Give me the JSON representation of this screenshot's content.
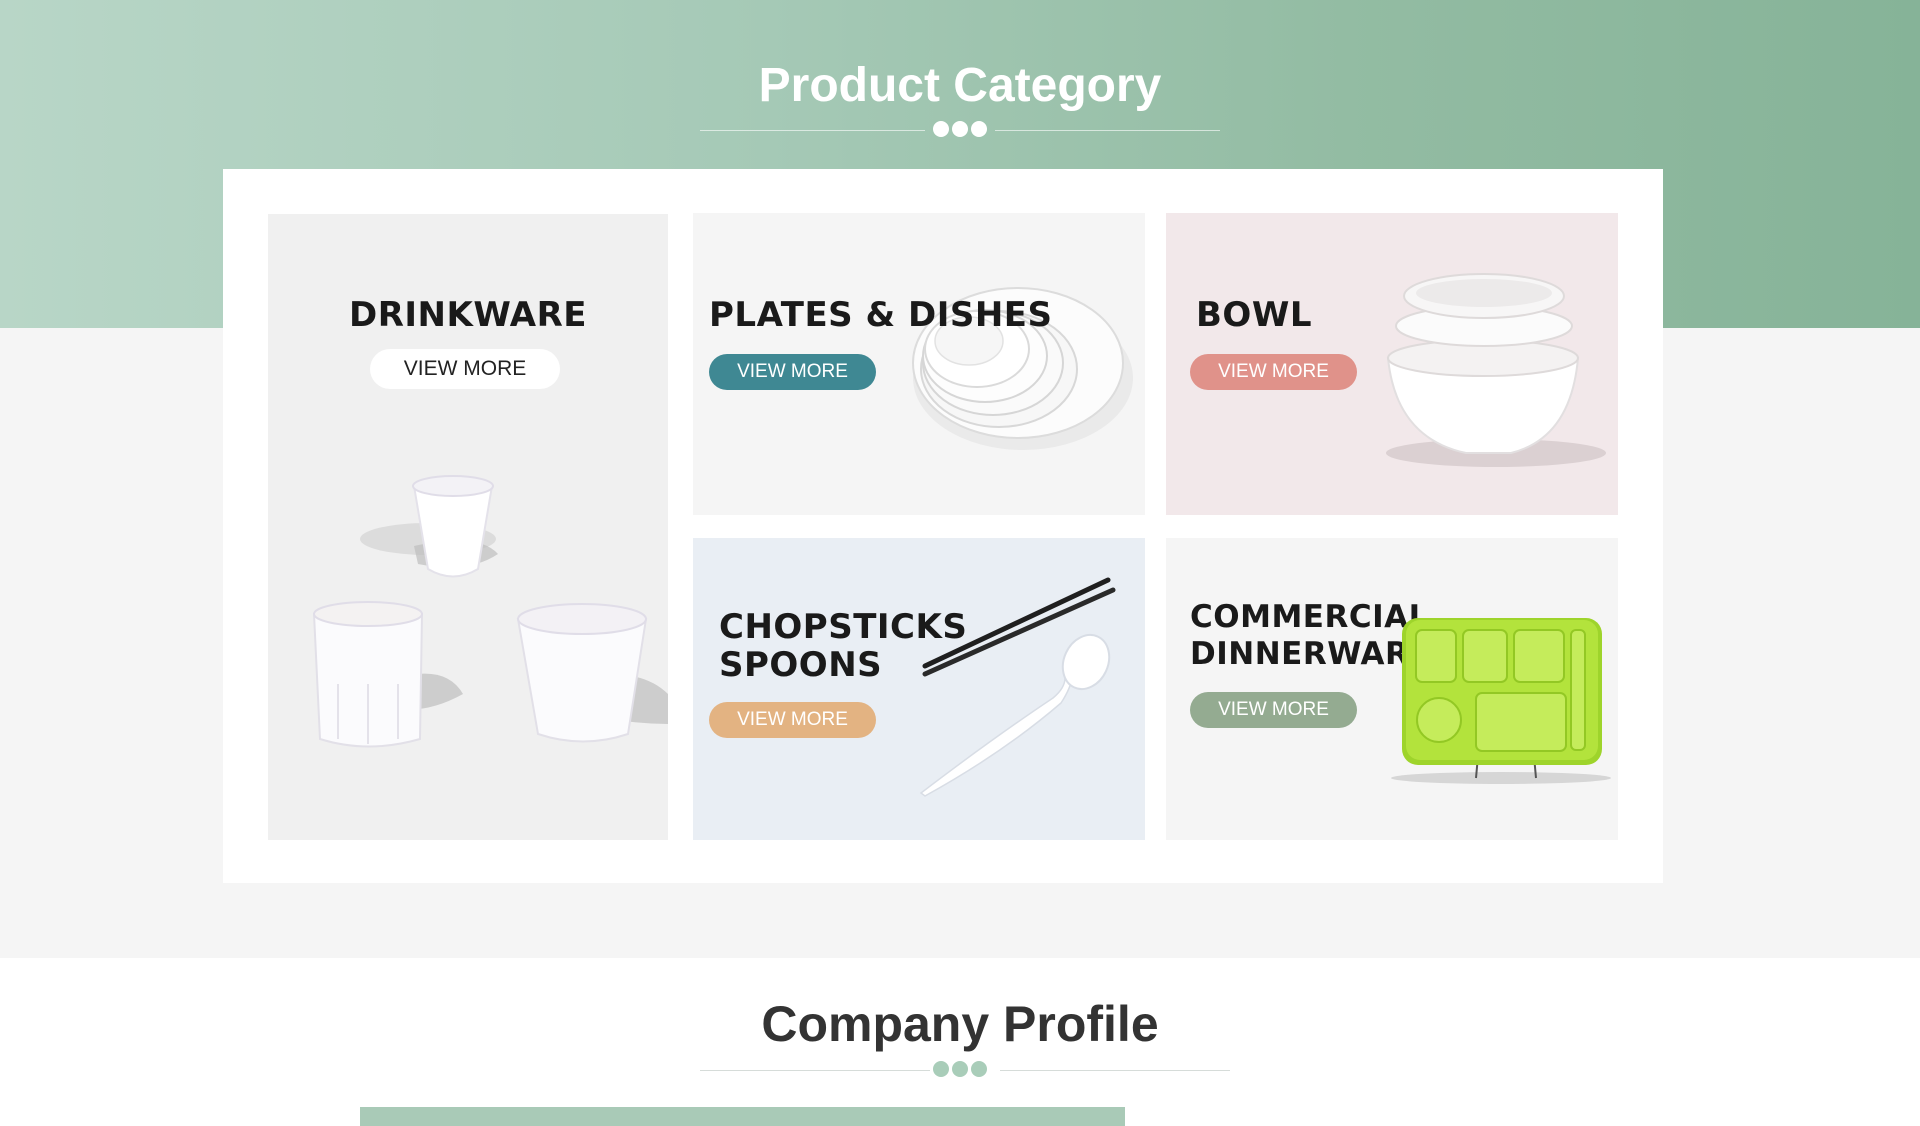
{
  "product_category": {
    "title": "Product Category",
    "cards": [
      {
        "title": "DRINKWARE",
        "button": "VIEW MORE",
        "image": "white-cups-image",
        "background": "#f0f0f0",
        "button_color": "#ffffff"
      },
      {
        "title": "PLATES & DISHES",
        "button": "VIEW MORE",
        "image": "stacked-plates-image",
        "background": "#f5f5f5",
        "button_color": "#3f8893"
      },
      {
        "title": "BOWL",
        "button": "VIEW MORE",
        "image": "stacked-bowls-image",
        "background": "#f2e8ea",
        "button_color": "#e0928a"
      },
      {
        "title_line1": "CHOPSTICKS",
        "title_line2": "SPOONS",
        "button": "VIEW MORE",
        "image": "chopsticks-spoon-image",
        "background": "#e9eef4",
        "button_color": "#e3b382"
      },
      {
        "title_line1": "COMMERCIAL",
        "title_line2": "DINNERWARE",
        "button": "VIEW MORE",
        "image": "green-tray-image",
        "background": "#f5f5f5",
        "button_color": "#94ab91"
      }
    ]
  },
  "company_profile": {
    "title": "Company Profile"
  },
  "colors": {
    "hero_green": "#9ec4af",
    "page_background": "#f5f5f5",
    "divider_dot_light": "#ffffff",
    "divider_dot_green": "#a9cdb9"
  }
}
